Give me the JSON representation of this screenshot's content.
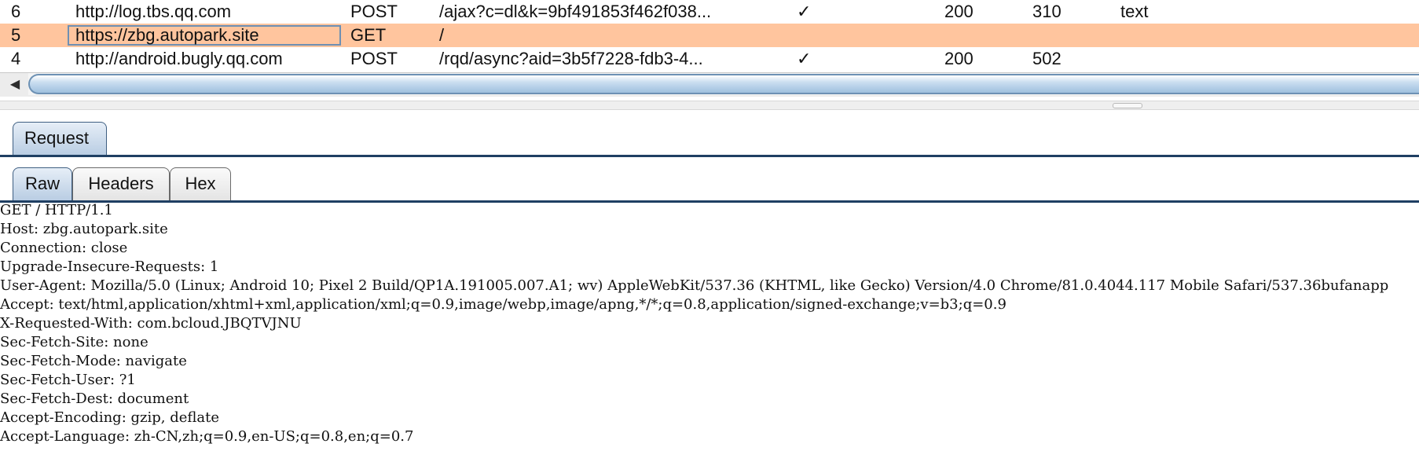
{
  "history": {
    "rows": [
      {
        "num": "6",
        "host": "http://log.tbs.qq.com",
        "method": "POST",
        "url": "/ajax?c=dl&k=9bf491853f462f038...",
        "edited": "✓",
        "status": "200",
        "length": "310",
        "mime": "text",
        "selected": false
      },
      {
        "num": "5",
        "host": "https://zbg.autopark.site",
        "method": "GET",
        "url": "/",
        "edited": "",
        "status": "",
        "length": "",
        "mime": "",
        "selected": true
      },
      {
        "num": "4",
        "host": "http://android.bugly.qq.com",
        "method": "POST",
        "url": "/rqd/async?aid=3b5f7228-fdb3-4...",
        "edited": "✓",
        "status": "200",
        "length": "502",
        "mime": "",
        "selected": false
      }
    ]
  },
  "scrollbar": {
    "left_arrow": "◀"
  },
  "colors": {
    "selected_row": "#ffc59e",
    "tab_underline": "#1f3f63",
    "scroll_thumb": "#9fc0de"
  },
  "outer_tabs": {
    "request": "Request"
  },
  "inner_tabs": {
    "raw": "Raw",
    "headers": "Headers",
    "hex": "Hex"
  },
  "raw_request": {
    "lines": [
      "GET / HTTP/1.1",
      "Host: zbg.autopark.site",
      "Connection: close",
      "Upgrade-Insecure-Requests: 1",
      "User-Agent: Mozilla/5.0 (Linux; Android 10; Pixel 2 Build/QP1A.191005.007.A1; wv) AppleWebKit/537.36 (KHTML, like Gecko) Version/4.0 Chrome/81.0.4044.117 Mobile Safari/537.36bufanapp",
      "Accept: text/html,application/xhtml+xml,application/xml;q=0.9,image/webp,image/apng,*/*;q=0.8,application/signed-exchange;v=b3;q=0.9",
      "X-Requested-With: com.bcloud.JBQTVJNU",
      "Sec-Fetch-Site: none",
      "Sec-Fetch-Mode: navigate",
      "Sec-Fetch-User: ?1",
      "Sec-Fetch-Dest: document",
      "Accept-Encoding: gzip, deflate",
      "Accept-Language: zh-CN,zh;q=0.9,en-US;q=0.8,en;q=0.7"
    ]
  }
}
